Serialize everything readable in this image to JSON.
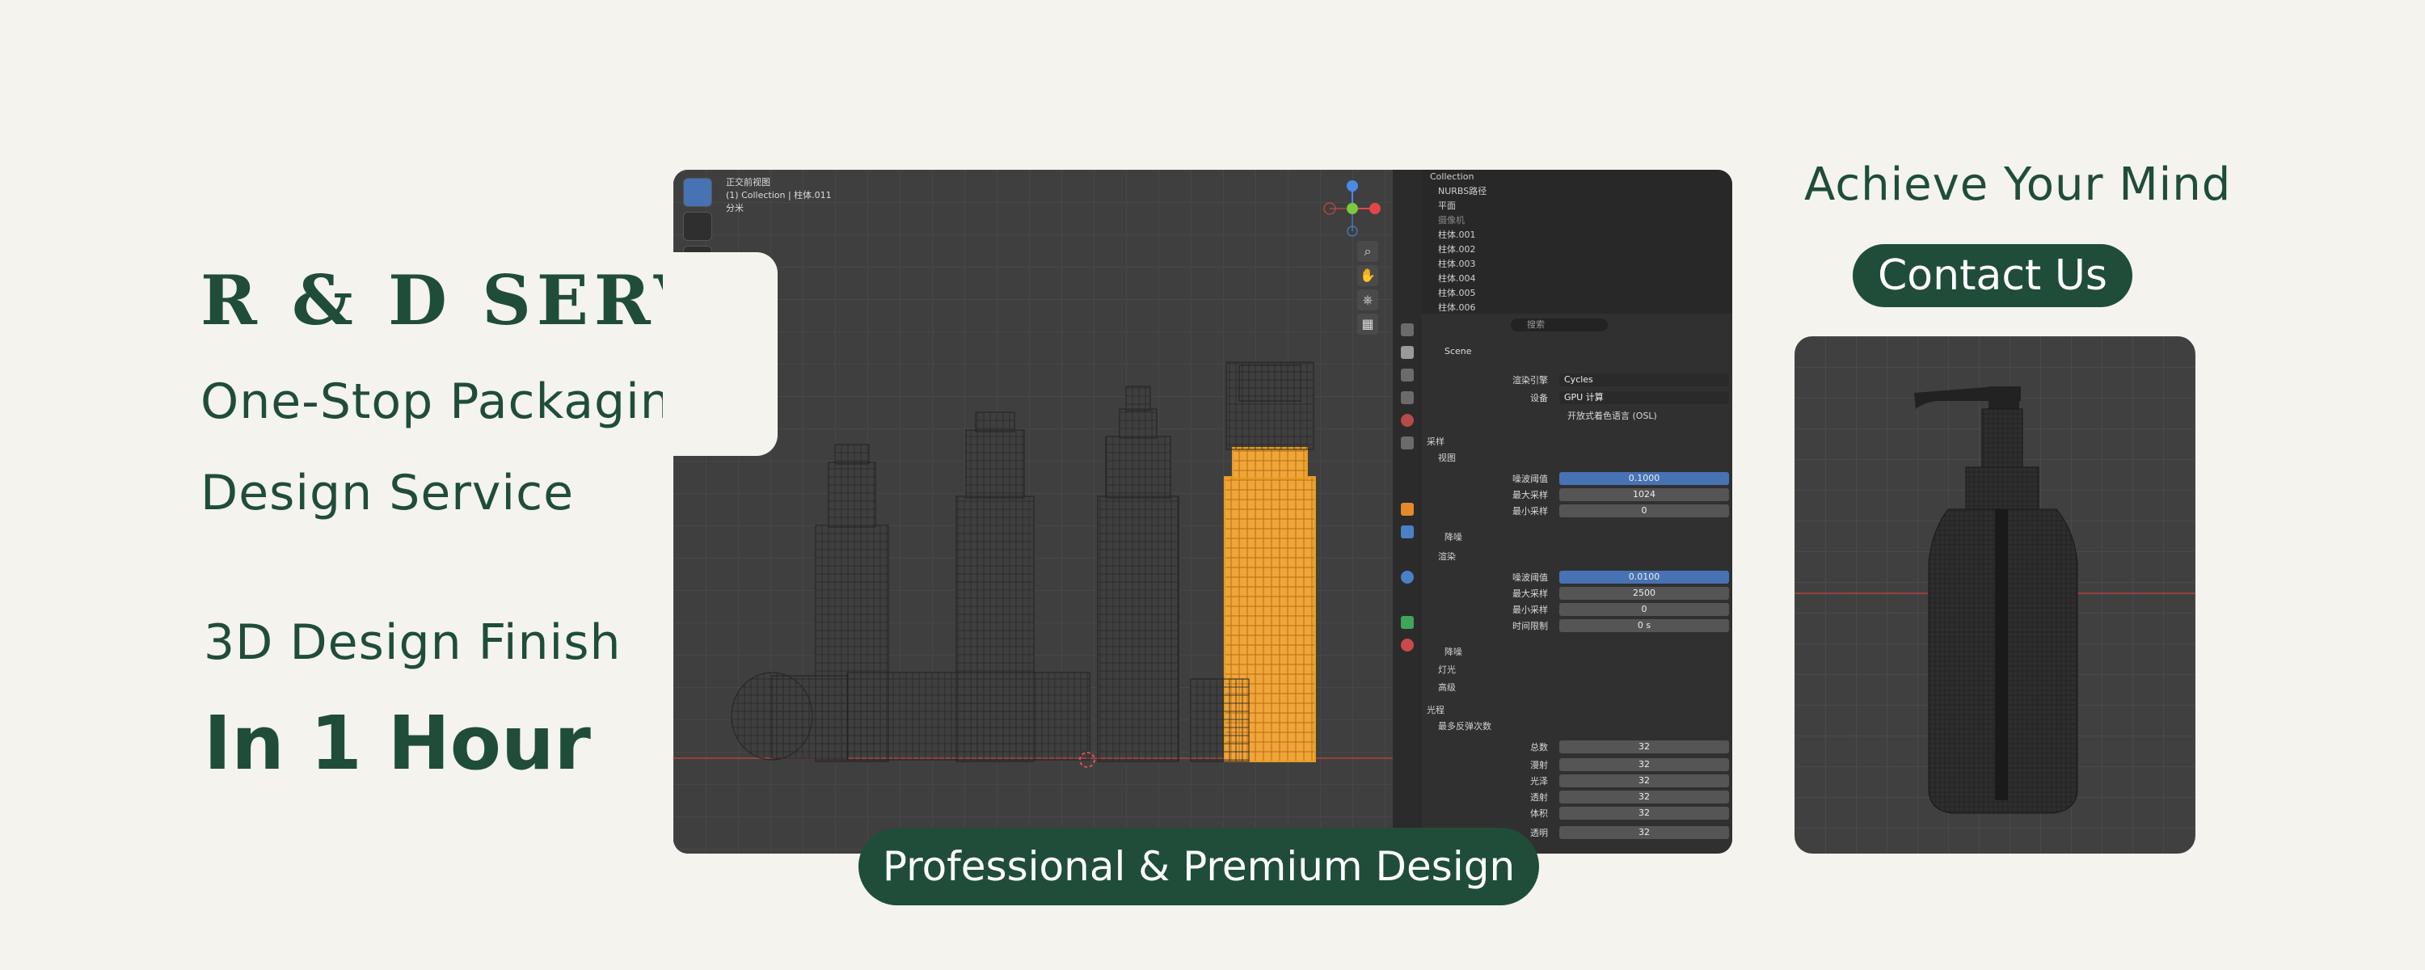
{
  "hero": {
    "title": "R & D SERVICE",
    "subtitle_line1": "One-Stop Packaging",
    "subtitle_line2": "Design Service",
    "finish_line": "3D Design Finish",
    "hour_line": "In 1 Hour"
  },
  "right": {
    "tagline": "Achieve Your Mind",
    "contact_button": "Contact Us"
  },
  "footer_pill": "Professional & Premium Design",
  "blender": {
    "viewport_info": [
      "正交前视图",
      "(1) Collection | 柱体.011",
      "分米"
    ],
    "outliner": {
      "root": "Collection",
      "items": [
        "NURBS路径",
        "平面",
        "摄像机",
        "柱体.001",
        "柱体.002",
        "柱体.003",
        "柱体.004",
        "柱体.005",
        "柱体.006"
      ]
    },
    "search_placeholder": "搜索",
    "scene_label": "Scene",
    "render_engine_label": "渲染引擎",
    "render_engine_value": "Cycles",
    "device_label": "设备",
    "device_value": "GPU 计算",
    "osl_label": "开放式着色语言 (OSL)",
    "sampling": {
      "section": "采样",
      "viewport": "视图",
      "noise_threshold_label": "噪波阈值",
      "viewport_noise": "0.1000",
      "max_samples_label": "最大采样",
      "viewport_max": "1024",
      "min_samples_label": "最小采样",
      "viewport_min": "0",
      "denoise": "降噪",
      "render": "渲染",
      "render_noise": "0.0100",
      "render_max": "2500",
      "render_min": "0",
      "time_limit_label": "时间限制",
      "time_limit": "0 s",
      "denoise2": "降噪",
      "lights": "灯光",
      "advanced": "高级"
    },
    "light_paths": {
      "section": "光程",
      "max_bounces": "最多反弹次数",
      "rows": [
        {
          "label": "总数",
          "value": "32"
        },
        {
          "label": "漫射",
          "value": "32"
        },
        {
          "label": "光泽",
          "value": "32"
        },
        {
          "label": "透射",
          "value": "32"
        },
        {
          "label": "体积",
          "value": "32"
        },
        {
          "label": "透明",
          "value": "32"
        }
      ]
    }
  },
  "colors": {
    "brand_green": "#1f4d3a",
    "background": "#f4f3ee",
    "selection_orange": "#e89a1c"
  }
}
